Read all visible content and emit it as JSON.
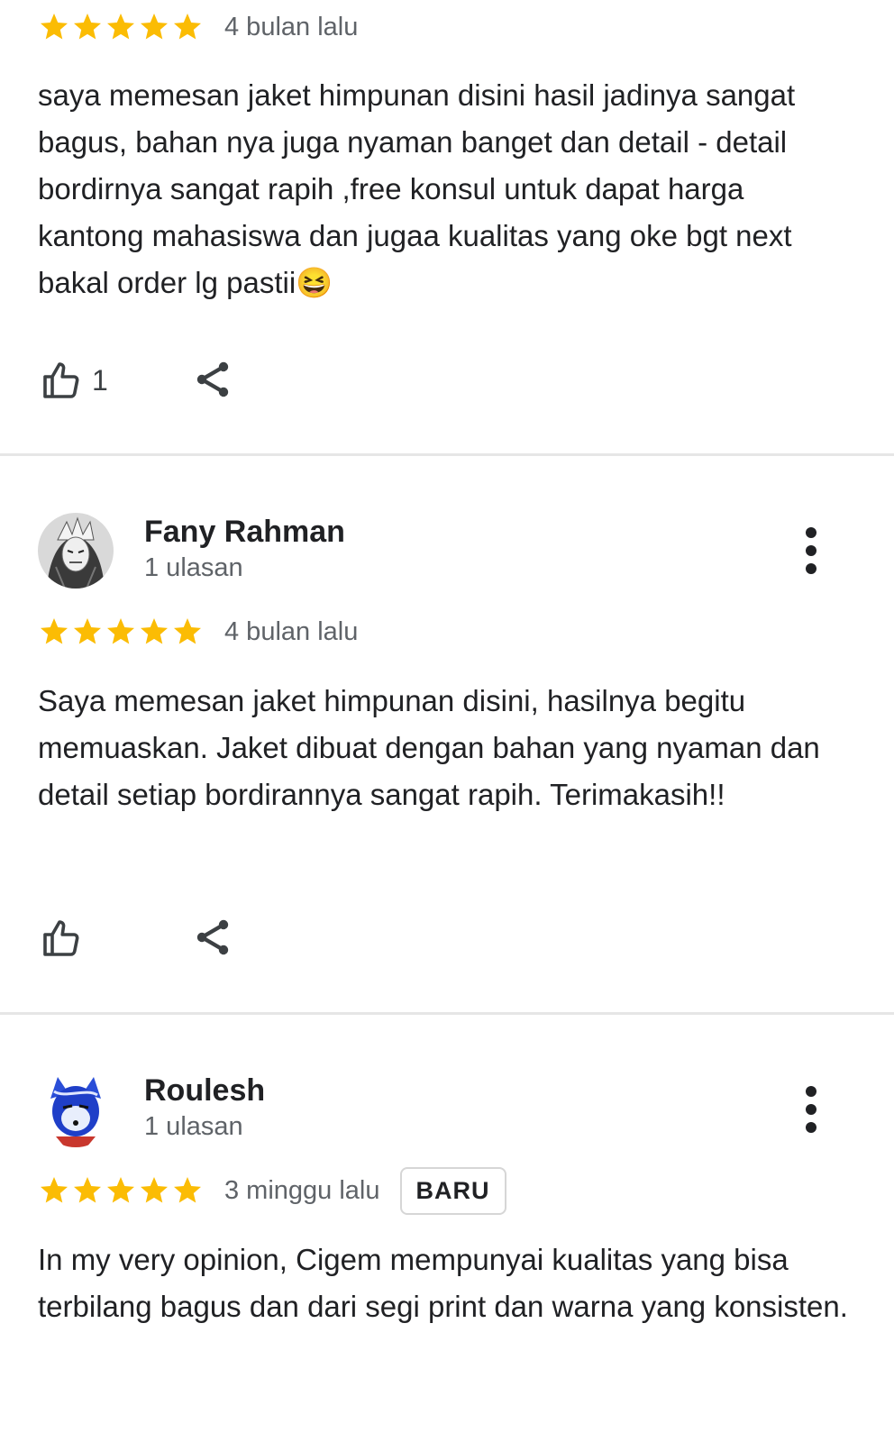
{
  "colors": {
    "star": "#fbbc04",
    "text": "#202124",
    "muted": "#5f6368",
    "divider": "#e6e6e6"
  },
  "icons": {
    "star": "star-icon",
    "like": "thumb-up-icon",
    "share": "share-icon",
    "more": "more-vert-icon",
    "emoji": "grinning-squinting-face-emoji"
  },
  "reviews": [
    {
      "rating": 5,
      "time": "4 bulan lalu",
      "text": "saya memesan jaket himpunan disini hasil jadinya sangat bagus, bahan nya juga nyaman banget dan detail - detail bordirnya sangat rapih ,free konsul untuk dapat harga kantong mahasiswa dan jugaa kualitas yang oke bgt next bakal order lg pastii",
      "emoji": "😆",
      "likes": "1"
    },
    {
      "name": "Fany Rahman",
      "review_count": "1 ulasan",
      "rating": 5,
      "time": "4 bulan lalu",
      "text": "Saya memesan jaket himpunan disini, hasilnya begitu memuaskan. Jaket dibuat dengan bahan yang nyaman dan detail setiap bordirannya sangat rapih. Terimakasih!!",
      "likes": ""
    },
    {
      "name": "Roulesh",
      "review_count": "1 ulasan",
      "rating": 5,
      "time": "3 minggu lalu",
      "badge": "BARU",
      "text": "In my very opinion, Cigem mempunyai kualitas yang bisa terbilang bagus dan dari segi print dan warna yang konsisten."
    }
  ]
}
